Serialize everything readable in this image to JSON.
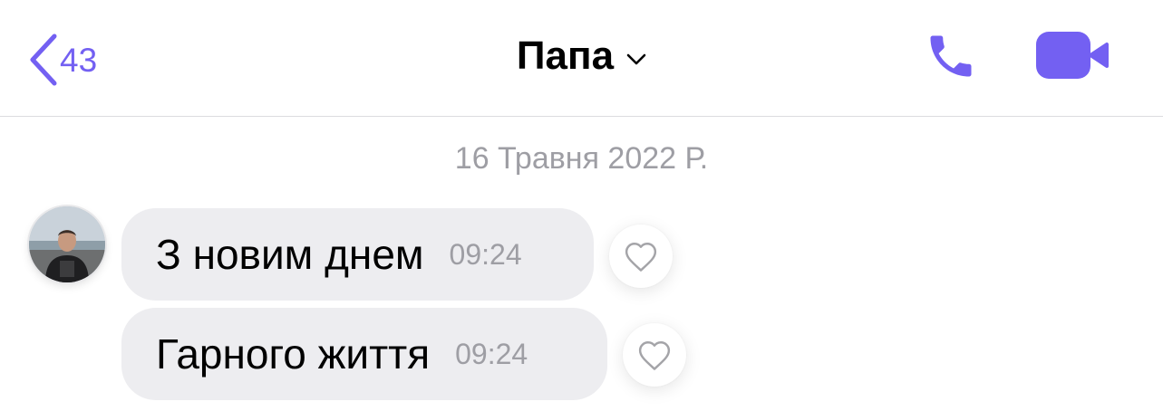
{
  "header": {
    "back_count": "43",
    "title": "Папа",
    "accent_color": "#7360f2"
  },
  "conversation": {
    "date_label": "16 Травня 2022 Р.",
    "messages": [
      {
        "text": "З новим днем",
        "time": "09:24"
      },
      {
        "text": "Гарного життя",
        "time": "09:24"
      }
    ]
  },
  "icons": {
    "back": "chevron-left-icon",
    "title_dropdown": "chevron-down-icon",
    "call": "phone-icon",
    "video": "video-camera-icon",
    "like": "heart-outline-icon"
  }
}
